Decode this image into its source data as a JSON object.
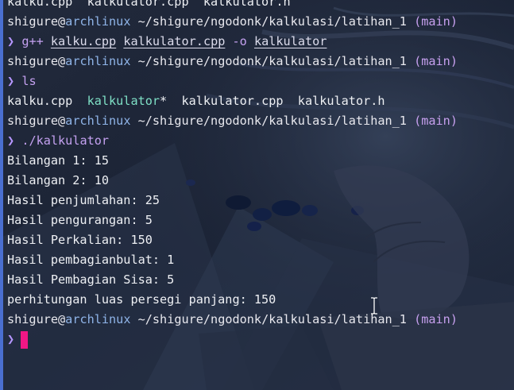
{
  "prompt": {
    "user": "shigure",
    "at": "@",
    "host": "archlinux",
    "path": "~/shigure/ngodonk/kalkulasi/latihan_1",
    "branch": "(main)",
    "chevron": "❯"
  },
  "top_cut_line": "kalku.cpp  kalkulator.cpp  kalkulator.h",
  "commands": {
    "compile": {
      "program": "g++",
      "file1": "kalku.cpp",
      "file2": "kalkulator.cpp",
      "flag": "-o",
      "output": "kalkulator"
    },
    "list": "ls",
    "run": "./kalkulator"
  },
  "ls_output": {
    "file1": "kalku.cpp",
    "exec": "kalkulator",
    "exec_suffix": "*",
    "file2": "kalkulator.cpp",
    "file3": "kalkulator.h"
  },
  "program_output": [
    "Bilangan 1: 15",
    "Bilangan 2: 10",
    "Hasil penjumlahan: 25",
    "Hasil pengurangan: 5",
    "Hasil Perkalian: 150",
    "Hasil pembagianbulat: 1",
    "Hasil Pembagian Sisa: 5",
    "perhitungan luas persegi panjang: 150"
  ],
  "colors": {
    "cursor": "#f01785",
    "host": "#8fb4e8",
    "branch": "#c7a0ef",
    "executable": "#7fe0c6",
    "edge": "#4a6fd0"
  }
}
